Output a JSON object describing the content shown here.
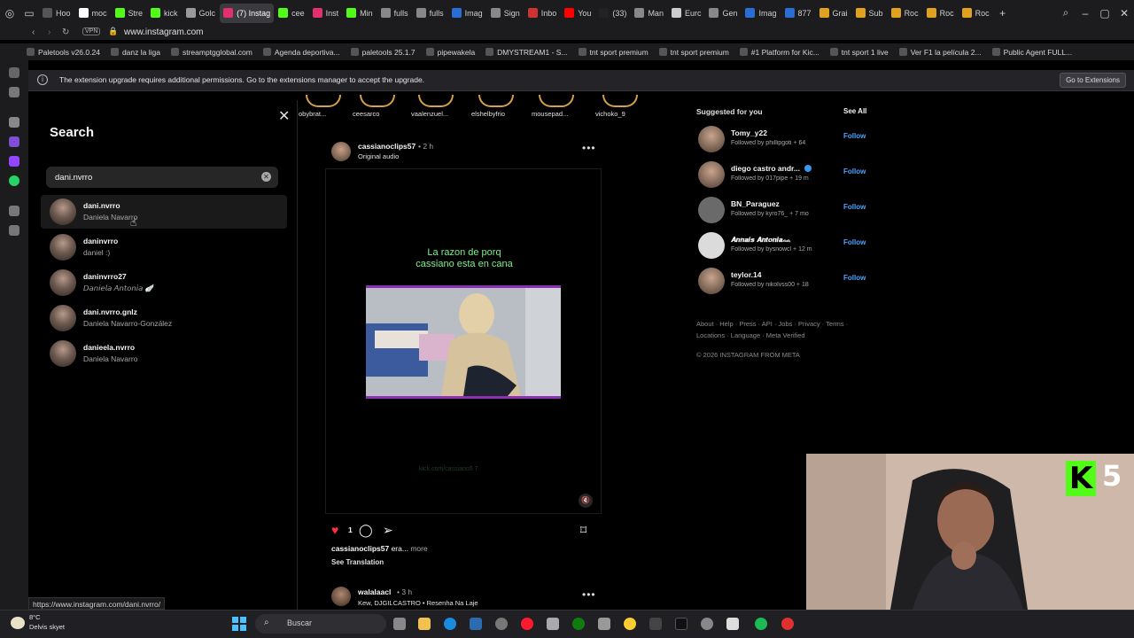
{
  "browser": {
    "tabs": [
      {
        "label": "Hoo",
        "color": "#555555"
      },
      {
        "label": "moc",
        "color": "#ffffff"
      },
      {
        "label": "Stre",
        "color": "#53fc18"
      },
      {
        "label": "kick",
        "color": "#53fc18"
      },
      {
        "label": "Golc",
        "color": "#999999"
      },
      {
        "label": "(7) Instag",
        "color": "#e1306c"
      },
      {
        "label": "cee",
        "color": "#53fc18"
      },
      {
        "label": "Inst",
        "color": "#e1306c"
      },
      {
        "label": "Min",
        "color": "#53fc18"
      },
      {
        "label": "fulls",
        "color": "#888888"
      },
      {
        "label": "fulls",
        "color": "#888888"
      },
      {
        "label": "Imag",
        "color": "#2a6ed4"
      },
      {
        "label": "Sign",
        "color": "#888888"
      },
      {
        "label": "Inbo",
        "color": "#cc3333"
      },
      {
        "label": "You",
        "color": "#ff0000"
      },
      {
        "label": "(33)",
        "color": "#222222"
      },
      {
        "label": "Man",
        "color": "#888888"
      },
      {
        "label": "Eurc",
        "color": "#cccccc"
      },
      {
        "label": "Gen",
        "color": "#888888"
      },
      {
        "label": "Imag",
        "color": "#2a6ed4"
      },
      {
        "label": "877",
        "color": "#2a6ed4"
      },
      {
        "label": "Grai",
        "color": "#e0a020"
      },
      {
        "label": "Sub",
        "color": "#e0a020"
      },
      {
        "label": "Roc",
        "color": "#e0a020"
      },
      {
        "label": "Roc",
        "color": "#e0a020"
      },
      {
        "label": "Roc",
        "color": "#e0a020"
      }
    ],
    "active_tab_index": 5,
    "url": "www.instagram.com",
    "vpn_label": "VPN",
    "bookmarks": [
      "Paletools v26.0.24",
      "danz la liga",
      "streamptgglobal.com",
      "Agenda deportiva...",
      "paletools 25.1.7",
      "pipewakela",
      "DMYSTREAM1 - S...",
      "tnt sport premium",
      "tnt sport premium",
      "#1 Platform for Kic...",
      "tnt sport 1 live",
      "Ver F1 la película 2...",
      "Public Agent FULL..."
    ],
    "notice_text": "The extension upgrade requires additional permissions. Go to the extensions manager to accept the upgrade.",
    "notice_button": "Go to Extensions",
    "status_url": "https://www.instagram.com/dani.nvrro/"
  },
  "search": {
    "title": "Search",
    "query": "dani.nvrro",
    "results": [
      {
        "username": "dani.nvrro",
        "fullname": "Daniela Navarro",
        "hover": true
      },
      {
        "username": "daninvrro",
        "fullname": "daniel :)",
        "hover": false
      },
      {
        "username": "daninvrro27",
        "fullname": "𝘋𝘢𝘯𝘪𝘦𝘭𝘢 𝘈𝘯𝘵𝘰𝘯𝘪𝘢 🪽",
        "hover": false
      },
      {
        "username": "dani.nvrro.gnlz",
        "fullname": "Daniela Navarro-González",
        "hover": false
      },
      {
        "username": "danieela.nvrro",
        "fullname": "Daniela Navarro",
        "hover": false
      }
    ]
  },
  "stories": [
    "obybrat...",
    "ceesarco",
    "vaalenzuel...",
    "elshelbyfrio",
    "mousepad...",
    "vichoko_9"
  ],
  "post": {
    "username": "cassianoclips57",
    "time": "• 2 h",
    "audio": "Original audio",
    "video_caption_line1": "La razon de porq",
    "video_caption_line2": "cassiano esta en cana",
    "watermark": "kick.com/cassiano5 7",
    "likes": "1",
    "caption_user": "cassianoclips57",
    "caption_text": " era...",
    "more": "more",
    "see_translation": "See Translation"
  },
  "next_post": {
    "username": "walalaacl",
    "time": "• 3 h",
    "audio": "Kew, DJGILCASTRO • Resenha Na Laje"
  },
  "suggested": {
    "title": "Suggested for you",
    "see_all": "See All",
    "follow_label": "Follow",
    "users": [
      {
        "name": "Tomy_y22",
        "sub": "Followed by phillipgoti + 64"
      },
      {
        "name": "diego castro andr...",
        "sub": "Followed by 017pipe + 19 m"
      },
      {
        "name": "BN_Paraguez",
        "sub": "Followed by kyro76_ + 7 mo"
      },
      {
        "name": "𝘼𝙣𝙣𝙖𝙞𝙨 𝘼𝙣𝙩𝙤𝙣𝙞𝙖ᨐ",
        "sub": "Followed by bysnowcl + 12 m"
      },
      {
        "name": "teylor.14",
        "sub": "Followed by nikolvss00 + 18"
      }
    ],
    "footer_links": "About · Help · Press · API · Jobs · Privacy · Terms · Locations · Language · Meta Verified",
    "copyright": "© 2026 INSTAGRAM FROM META"
  },
  "overlay": {
    "k_letter": "K",
    "k_number": "5"
  },
  "taskbar": {
    "weather_temp": "8°C",
    "weather_desc": "Delvis skyet",
    "search_label": "Buscar"
  }
}
